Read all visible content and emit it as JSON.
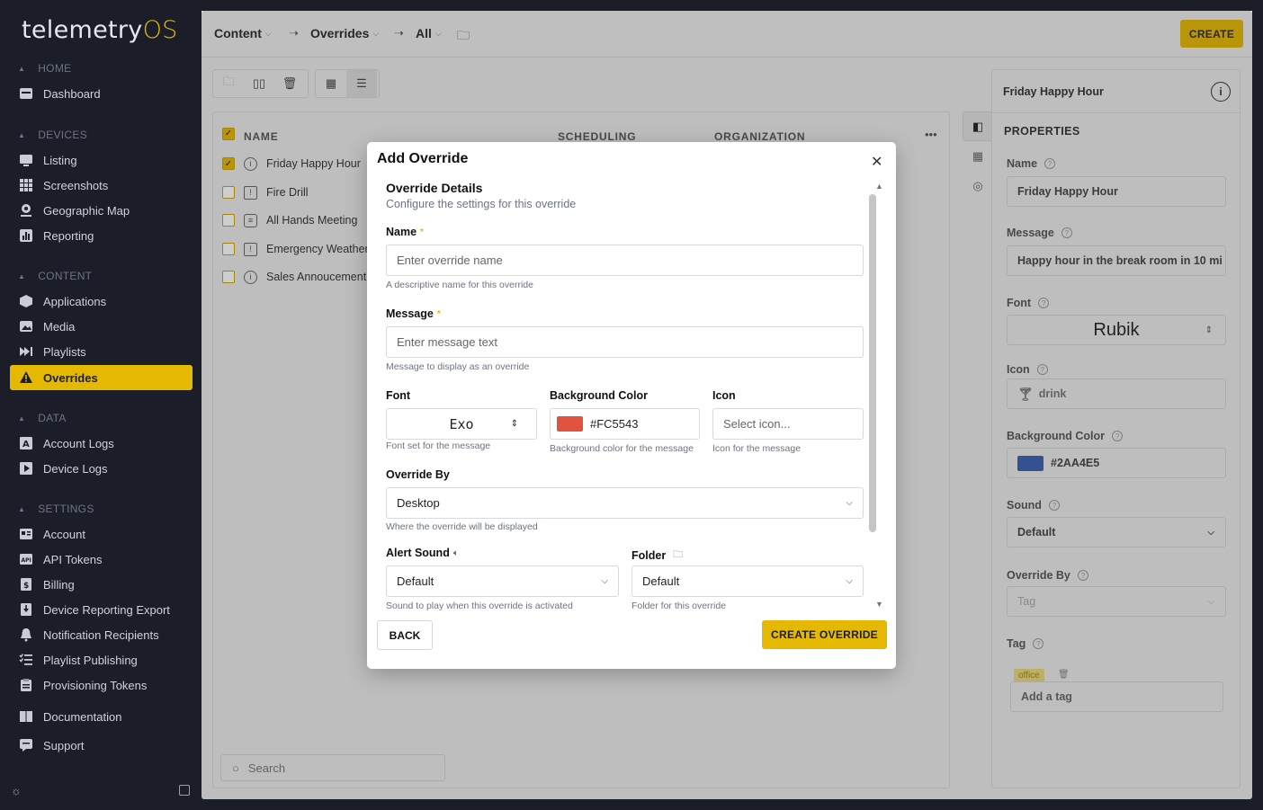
{
  "app": {
    "logo_main": "telemetry",
    "logo_os": "OS"
  },
  "sidebar": {
    "sections": [
      {
        "label": "HOME",
        "items": [
          {
            "label": "Dashboard",
            "icon": "dashboard-icon"
          }
        ]
      },
      {
        "label": "DEVICES",
        "items": [
          {
            "label": "Listing",
            "icon": "monitor-icon"
          },
          {
            "label": "Screenshots",
            "icon": "grid-icon"
          },
          {
            "label": "Geographic Map",
            "icon": "map-pin-icon"
          },
          {
            "label": "Reporting",
            "icon": "bar-chart-icon"
          }
        ]
      },
      {
        "label": "CONTENT",
        "items": [
          {
            "label": "Applications",
            "icon": "box-icon"
          },
          {
            "label": "Media",
            "icon": "image-icon"
          },
          {
            "label": "Playlists",
            "icon": "playlist-icon"
          },
          {
            "label": "Overrides",
            "icon": "warning-icon",
            "active": true
          }
        ]
      },
      {
        "label": "DATA",
        "items": [
          {
            "label": "Account Logs",
            "icon": "log-icon"
          },
          {
            "label": "Device Logs",
            "icon": "play-log-icon"
          }
        ]
      },
      {
        "label": "SETTINGS",
        "items": [
          {
            "label": "Account",
            "icon": "account-icon"
          },
          {
            "label": "API Tokens",
            "icon": "api-icon"
          },
          {
            "label": "Billing",
            "icon": "billing-icon"
          },
          {
            "label": "Device Reporting Export",
            "icon": "download-icon"
          },
          {
            "label": "Notification Recipients",
            "icon": "bell-icon"
          },
          {
            "label": "Playlist Publishing",
            "icon": "list-check-icon"
          },
          {
            "label": "Provisioning Tokens",
            "icon": "clipboard-icon"
          }
        ]
      }
    ],
    "extra": [
      {
        "label": "Documentation",
        "icon": "book-icon"
      },
      {
        "label": "Support",
        "icon": "chat-icon"
      }
    ]
  },
  "topbar": {
    "crumbs": [
      "Content",
      "Overrides",
      "All"
    ],
    "create_label": "CREATE"
  },
  "list": {
    "columns": [
      "NAME",
      "SCHEDULING",
      "ORGANIZATION"
    ],
    "rows": [
      {
        "name": "Friday Happy Hour",
        "checked": true
      },
      {
        "name": "Fire Drill",
        "checked": false
      },
      {
        "name": "All Hands Meeting",
        "checked": false
      },
      {
        "name": "Emergency Weather",
        "checked": false
      },
      {
        "name": "Sales Annoucement",
        "checked": false
      }
    ],
    "search_placeholder": "Search"
  },
  "properties": {
    "header": "Friday Happy Hour",
    "title": "PROPERTIES",
    "name_label": "Name",
    "name_value": "Friday Happy Hour",
    "message_label": "Message",
    "message_value": "Happy hour in the break room in 10 mi",
    "font_label": "Font",
    "font_value": "Rubik",
    "icon_label": "Icon",
    "icon_value": "drink",
    "bg_label": "Background Color",
    "bg_value": "#2AA4E5",
    "bg_swatch": "#3a5fb0",
    "sound_label": "Sound",
    "sound_value": "Default",
    "override_by_label": "Override By",
    "override_by_value": "Tag",
    "tag_label": "Tag",
    "tag_value": "office",
    "tag_placeholder": "Add a tag"
  },
  "modal": {
    "title": "Add Override",
    "section_title": "Override Details",
    "section_sub": "Configure the settings for this override",
    "name_label": "Name",
    "name_placeholder": "Enter override name",
    "name_hint": "A descriptive name for this override",
    "message_label": "Message",
    "message_placeholder": "Enter message text",
    "message_hint": "Message to display as an override",
    "font_label": "Font",
    "font_value": "Exo",
    "font_hint": "Font set for the message",
    "bg_label": "Background Color",
    "bg_value": "#FC5543",
    "bg_swatch": "#e2533f",
    "bg_hint": "Background color for the message",
    "icon_label": "Icon",
    "icon_placeholder": "Select icon...",
    "icon_hint": "Icon for the message",
    "override_by_label": "Override By",
    "override_by_value": "Desktop",
    "override_by_hint": "Where the override will be displayed",
    "alert_label": "Alert Sound",
    "alert_value": "Default",
    "alert_hint": "Sound to play when this override is activated",
    "folder_label": "Folder",
    "folder_value": "Default",
    "folder_hint": "Folder for this override",
    "back_label": "BACK",
    "create_label": "CREATE OVERRIDE",
    "required_mark": "*"
  },
  "colors": {
    "accent": "#e5b803",
    "sidebar_bg": "#1b1e29"
  }
}
